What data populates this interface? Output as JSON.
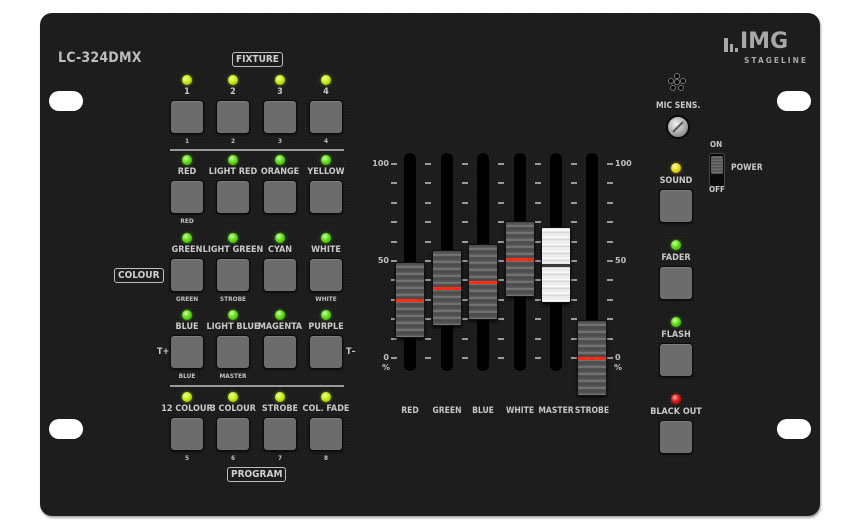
{
  "device": {
    "model": "LC-324DMX",
    "brand": {
      "name": "IMG",
      "sub": "STAGELINE"
    }
  },
  "sections": {
    "fixture": "FIXTURE",
    "colour": "COLOUR",
    "program": "PROGRAM"
  },
  "button_rows": [
    {
      "buttons": [
        {
          "label": "1",
          "sub": "1",
          "led": "yellow-green"
        },
        {
          "label": "2",
          "sub": "2",
          "led": "yellow-green"
        },
        {
          "label": "3",
          "sub": "3",
          "led": "yellow-green"
        },
        {
          "label": "4",
          "sub": "4",
          "led": "yellow-green"
        }
      ]
    },
    {
      "buttons": [
        {
          "label": "RED",
          "sub": "RED",
          "led": "green"
        },
        {
          "label": "LIGHT RED",
          "sub": "",
          "led": "green"
        },
        {
          "label": "ORANGE",
          "sub": "",
          "led": "green"
        },
        {
          "label": "YELLOW",
          "sub": "",
          "led": "green"
        }
      ]
    },
    {
      "buttons": [
        {
          "label": "GREEN",
          "sub": "GREEN",
          "led": "green"
        },
        {
          "label": "LIGHT GREEN",
          "sub": "STROBE",
          "led": "green"
        },
        {
          "label": "CYAN",
          "sub": "",
          "led": "green"
        },
        {
          "label": "WHITE",
          "sub": "WHITE",
          "led": "green"
        }
      ]
    },
    {
      "buttons": [
        {
          "label": "BLUE",
          "sub": "BLUE",
          "led": "green"
        },
        {
          "label": "LIGHT BLUE",
          "sub": "MASTER",
          "led": "green"
        },
        {
          "label": "MAGENTA",
          "sub": "",
          "led": "green"
        },
        {
          "label": "PURPLE",
          "sub": "",
          "led": "green"
        }
      ]
    },
    {
      "buttons": [
        {
          "label": "12 COLOUR",
          "sub": "5",
          "led": "yellow-green"
        },
        {
          "label": "3 COLOUR",
          "sub": "6",
          "led": "yellow-green"
        },
        {
          "label": "STROBE",
          "sub": "7",
          "led": "yellow-green"
        },
        {
          "label": "COL. FADE",
          "sub": "8",
          "led": "yellow-green"
        }
      ]
    }
  ],
  "tempo": {
    "plus": "T+",
    "minus": "T–"
  },
  "faders": {
    "scale": {
      "top": "100",
      "mid": "50",
      "bottom": "0",
      "unit": "%"
    },
    "channels": [
      {
        "label": "RED",
        "value_pct": 30,
        "style": "dark"
      },
      {
        "label": "GREEN",
        "value_pct": 36,
        "style": "dark"
      },
      {
        "label": "BLUE",
        "value_pct": 39,
        "style": "dark"
      },
      {
        "label": "WHITE",
        "value_pct": 51,
        "style": "dark"
      },
      {
        "label": "MASTER",
        "value_pct": 48,
        "style": "white"
      },
      {
        "label": "STROBE",
        "value_pct": 0,
        "style": "dark"
      }
    ]
  },
  "right_controls": {
    "mic_sens": "MIC SENS.",
    "power": {
      "label": "POWER",
      "on": "ON",
      "off": "OFF",
      "state": "ON"
    },
    "buttons": [
      {
        "label": "SOUND",
        "led": "yellow"
      },
      {
        "label": "FADER",
        "led": "green"
      },
      {
        "label": "FLASH",
        "led": "green"
      },
      {
        "label": "BLACK OUT",
        "led": "red"
      }
    ]
  }
}
